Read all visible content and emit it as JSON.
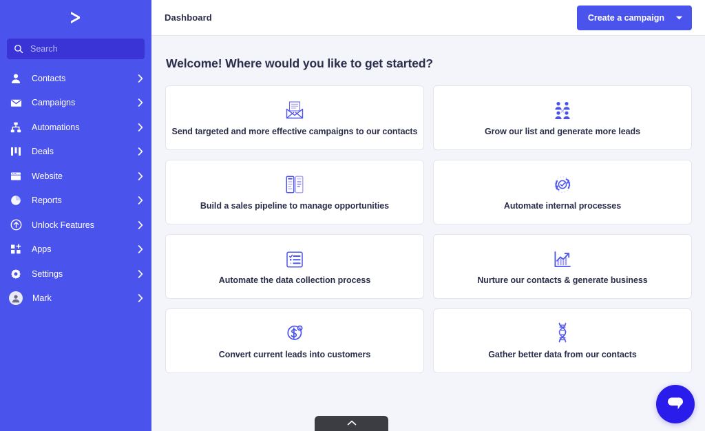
{
  "brand": {
    "logo_icon": "chevron-right-logo",
    "sidebar_color": "#4b53ed",
    "accent_color": "#4b53ed",
    "chat_color": "#2a1ceb",
    "page_bg": "#f4f4fb"
  },
  "sidebar": {
    "search": {
      "placeholder": "Search",
      "value": "",
      "icon": "search-icon"
    },
    "items": [
      {
        "label": "Contacts",
        "icon": "person-icon",
        "chevron": "chevron-right-icon"
      },
      {
        "label": "Campaigns",
        "icon": "envelope-icon",
        "chevron": "chevron-right-icon"
      },
      {
        "label": "Automations",
        "icon": "sitemap-icon",
        "chevron": "chevron-right-icon"
      },
      {
        "label": "Deals",
        "icon": "kanban-icon",
        "chevron": "chevron-right-icon"
      },
      {
        "label": "Website",
        "icon": "browser-icon",
        "chevron": "chevron-right-icon"
      },
      {
        "label": "Reports",
        "icon": "pie-chart-icon",
        "chevron": "chevron-right-icon"
      },
      {
        "label": "Unlock Features",
        "icon": "arrow-up-circle-icon",
        "chevron": "chevron-right-icon"
      }
    ],
    "bottom_items": [
      {
        "label": "Apps",
        "icon": "apps-grid-plus-icon",
        "chevron": "chevron-right-icon"
      },
      {
        "label": "Settings",
        "icon": "gear-icon",
        "chevron": "chevron-right-icon"
      },
      {
        "label": "Mark",
        "icon": "avatar-icon",
        "chevron": "chevron-right-icon"
      }
    ]
  },
  "topbar": {
    "breadcrumb": "Dashboard",
    "cta_label": "Create a campaign",
    "cta_caret_icon": "caret-down-icon"
  },
  "main": {
    "heading": "Welcome! Where would you like to get started?",
    "cards": [
      {
        "label": "Send targeted and more effective campaigns to our contacts",
        "icon": "open-envelope-icon"
      },
      {
        "label": "Grow our list and generate more leads",
        "icon": "people-group-icon"
      },
      {
        "label": "Build a sales pipeline to manage opportunities",
        "icon": "pipeline-cards-icon"
      },
      {
        "label": "Automate internal processes",
        "icon": "refresh-check-icon"
      },
      {
        "label": "Automate the data collection process",
        "icon": "checklist-icon"
      },
      {
        "label": "Nurture our contacts & generate business",
        "icon": "growth-chart-icon"
      },
      {
        "label": "Convert current leads into customers",
        "icon": "dollar-circle-icon"
      },
      {
        "label": "Gather better data from our contacts",
        "icon": "dna-helix-icon"
      }
    ]
  },
  "overlays": {
    "collapsed_panel": {
      "icon": "chevron-up-icon",
      "label": ""
    },
    "chat_bubble": {
      "icon": "chat-bubble-icon",
      "label": ""
    }
  }
}
